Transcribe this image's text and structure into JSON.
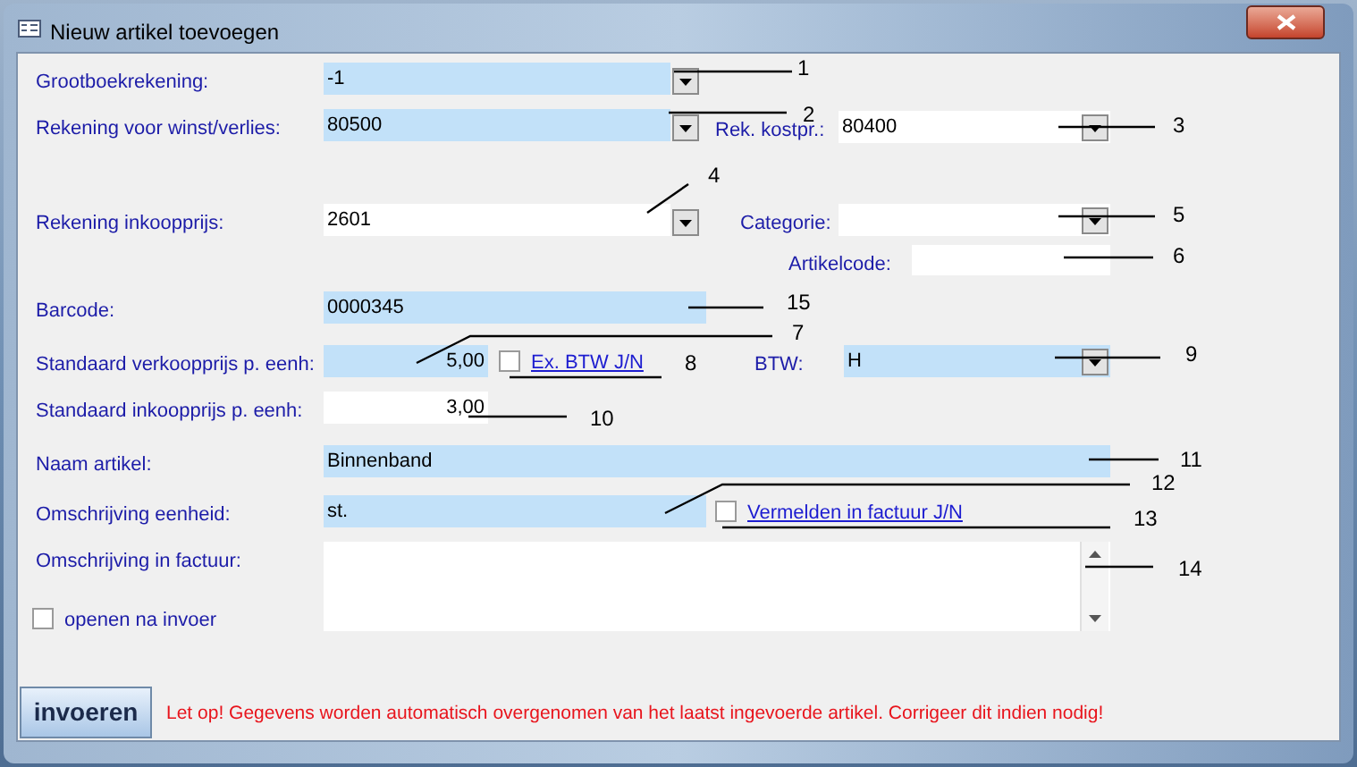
{
  "window": {
    "title": "Nieuw artikel toevoegen"
  },
  "fields": [
    {
      "kind": "combo",
      "label": "Grootboekrekening:",
      "value": "-1",
      "highlighted": true
    },
    {
      "kind": "combo",
      "label": "Rekening voor winst/verlies:",
      "value": "80500",
      "highlighted": true
    },
    {
      "kind": "combo",
      "label": "Rek. kostpr.:",
      "value": "80400",
      "highlighted": false
    },
    {
      "kind": "combo",
      "label": "Rekening inkoopprijs:",
      "value": "2601",
      "highlighted": false
    },
    {
      "kind": "combo",
      "label": "Categorie:",
      "highlighted": false
    },
    {
      "kind": "text",
      "label": "Artikelcode:",
      "highlighted": false
    },
    {
      "kind": "text",
      "label": "Barcode:",
      "value": "0000345",
      "highlighted": true
    },
    {
      "kind": "number",
      "label": "Standaard verkoopprijs p. eenh:",
      "value": "5,00",
      "highlighted": true
    },
    {
      "kind": "combo",
      "label": "BTW:",
      "value": "H",
      "highlighted": true
    },
    {
      "kind": "number",
      "label": "Standaard inkoopprijs p. eenh:",
      "value": "3,00",
      "highlighted": false
    },
    {
      "kind": "text",
      "label": "Naam artikel:",
      "value": "Binnenband",
      "highlighted": true
    },
    {
      "kind": "text",
      "label": "Omschrijving eenheid:",
      "value": "st.",
      "highlighted": true
    },
    {
      "kind": "memo",
      "label": "Omschrijving in factuur:",
      "highlighted": false
    }
  ],
  "checkboxes": [
    {
      "kind": "link",
      "label": "Ex. BTW J/N",
      "checked": false
    },
    {
      "kind": "link",
      "label": "Vermelden in factuur J/N",
      "checked": false
    },
    {
      "kind": "plain",
      "label": "openen na invoer",
      "checked": false
    }
  ],
  "button": "invoeren",
  "notice": "Let op! Gegevens worden automatisch overgenomen van het laatst ingevoerde artikel. Corrigeer dit indien nodig!",
  "callouts": [
    {
      "label": "1"
    },
    {
      "label": "2"
    },
    {
      "label": "3"
    },
    {
      "label": "4"
    },
    {
      "label": "5"
    },
    {
      "label": "6"
    },
    {
      "label": "15"
    },
    {
      "label": "7"
    },
    {
      "label": "8"
    },
    {
      "label": "9"
    },
    {
      "label": "10"
    },
    {
      "label": "11"
    },
    {
      "label": "12"
    },
    {
      "label": "13"
    },
    {
      "label": "14"
    }
  ]
}
